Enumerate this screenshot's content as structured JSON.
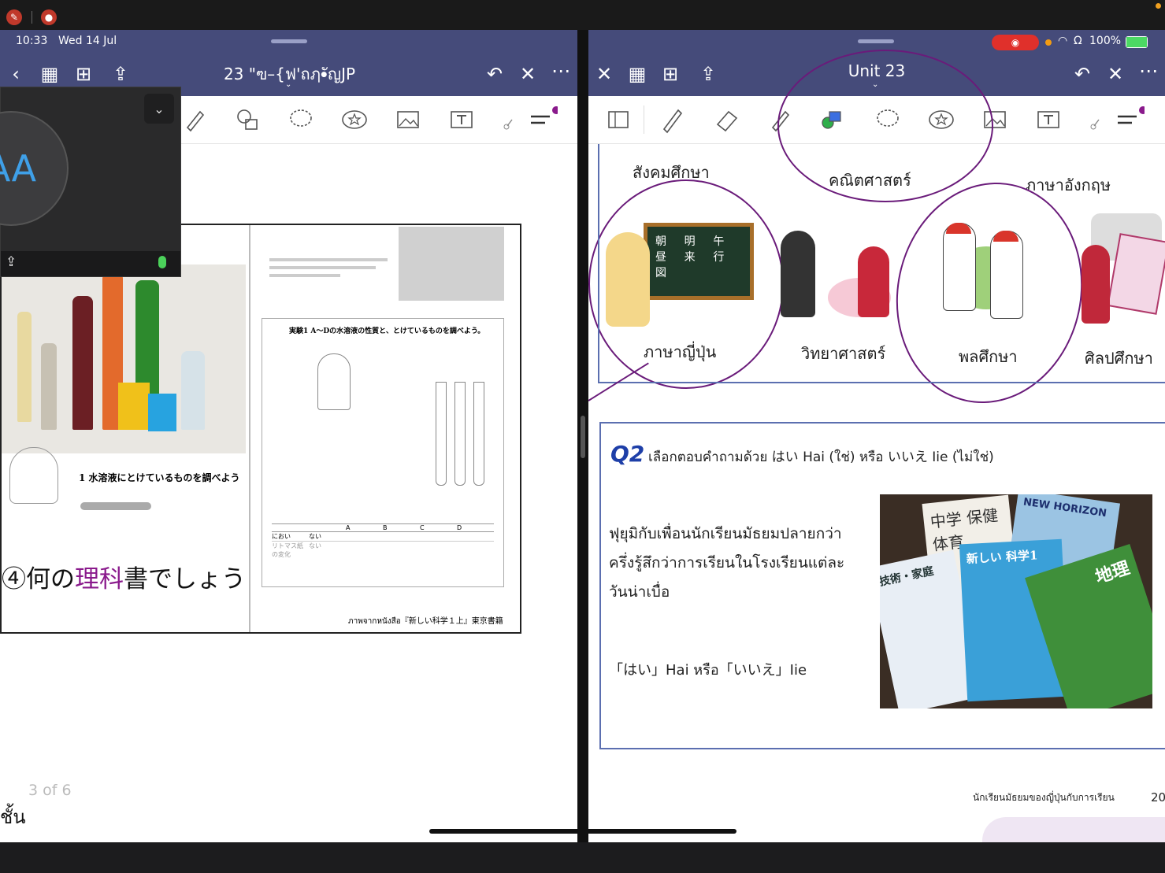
{
  "status": {
    "time": "10:33",
    "date": "Wed 14 Jul",
    "battery": "100%"
  },
  "left_pane": {
    "title": "23 \"ฃ–{ฟ'ถฦ•ัญJP",
    "page_counter": "3 of 6",
    "bottom_text": "ชั้น",
    "video_overlay": {
      "initials": "AA"
    },
    "textbook": {
      "japanese_annotation_prefix": "④何の",
      "japanese_annotation_highlight": "理科",
      "japanese_annotation_suffix": "書でしょう",
      "section_heading": "1 水溶液にとけているものを調べよう",
      "experiment_heading": "実験1 A〜Dの水溶液の性質と、とけているものを調べよう。",
      "source_caption": "ภาพจากหนังสือ『新しい科学１上』東京書籍",
      "table_headers": [
        "",
        "A",
        "B",
        "C",
        "D"
      ],
      "table_row_labels": [
        "におい",
        "リトマス紙の変化"
      ],
      "table_row_values": [
        "ない",
        "ない"
      ]
    }
  },
  "right_pane": {
    "title": "Unit 23",
    "subjects_top": [
      "สังคมศึกษา",
      "คณิตศาสตร์",
      "ภาษาอังกฤษ"
    ],
    "subjects": [
      "ภาษาญี่ปุ่น",
      "วิทยาศาสตร์",
      "พลศึกษา",
      "ศิลปศึกษา"
    ],
    "blackboard_kanji": [
      "朝",
      "明",
      "午",
      "昼",
      "来",
      "行",
      "図"
    ],
    "q2": {
      "label": "Q2",
      "instruction": "เลือกตอบคำถามด้วย はい Hai (ใช่) หรือ いいえ Iie (ไม่ใช่)",
      "statement_line1": "ฟุยุมิกับเพื่อนนักเรียนมัธยมปลายกว่า",
      "statement_line2": "ครึ่งรู้สึกว่าการเรียนในโรงเรียนแต่ละ",
      "statement_line3": "วันน่าเบื่อ",
      "answer_prompt": "「はい」Hai หรือ「いいえ」Iie",
      "book_titles": [
        "中学 保健体育",
        "NEW HORIZON",
        "新しい 科学1",
        "技術・家庭",
        "地理"
      ]
    },
    "footer": "นักเรียนมัธยมของญี่ปุ่นกับการเรียน",
    "page_number": "20"
  },
  "icons": {
    "left_header": [
      "back-icon",
      "grid-icon",
      "add-page-icon",
      "share-icon",
      "undo-icon",
      "close-icon",
      "more-icon"
    ],
    "right_header": [
      "close-icon",
      "grid-icon",
      "add-page-icon",
      "share-icon",
      "undo-icon",
      "close-icon",
      "more-icon"
    ]
  },
  "colors": {
    "header": "#454b7a",
    "annotation_purple": "#6a1b7a",
    "accent_blue": "#1e3fa8",
    "record_red": "#e0302b"
  }
}
